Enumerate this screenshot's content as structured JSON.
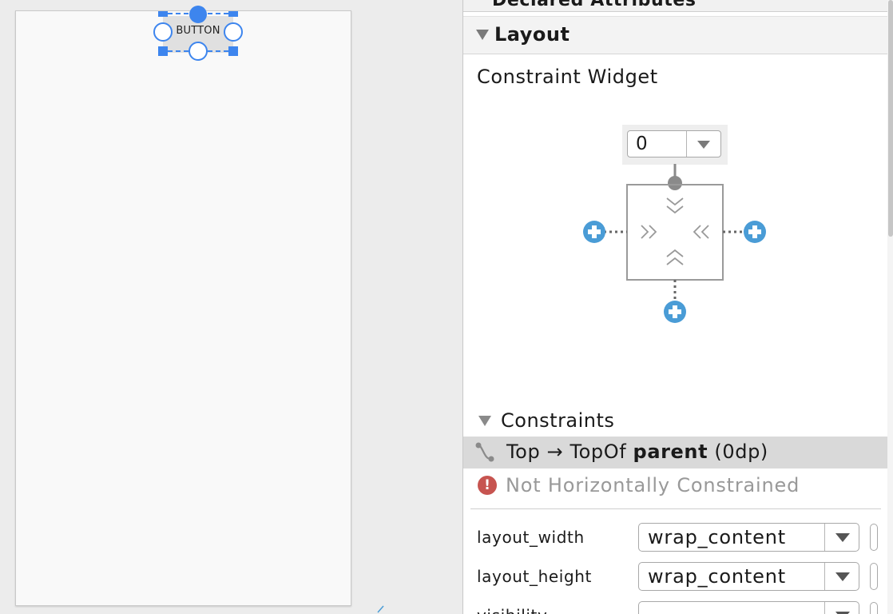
{
  "canvas": {
    "button_text": "BUTTON"
  },
  "panel": {
    "declared_section": {
      "title": "Declared Attributes"
    },
    "layout_section": {
      "title": "Layout"
    },
    "constraint_widget": {
      "title": "Constraint Widget",
      "top_margin": "0"
    },
    "constraints": {
      "title": "Constraints",
      "items": [
        {
          "text_prefix": "Top → TopOf ",
          "target": "parent",
          "text_suffix": " (0dp)"
        }
      ],
      "warning": "Not Horizontally Constrained"
    },
    "attributes": [
      {
        "label": "layout_width",
        "value": "wrap_content"
      },
      {
        "label": "layout_height",
        "value": "wrap_content"
      },
      {
        "label": "visibility",
        "value": ""
      }
    ]
  },
  "colors": {
    "selection_blue": "#3d85ee",
    "plus_blue": "#4a9cd6",
    "warning_red": "#c75450",
    "row_highlight": "#d9d9d9"
  }
}
